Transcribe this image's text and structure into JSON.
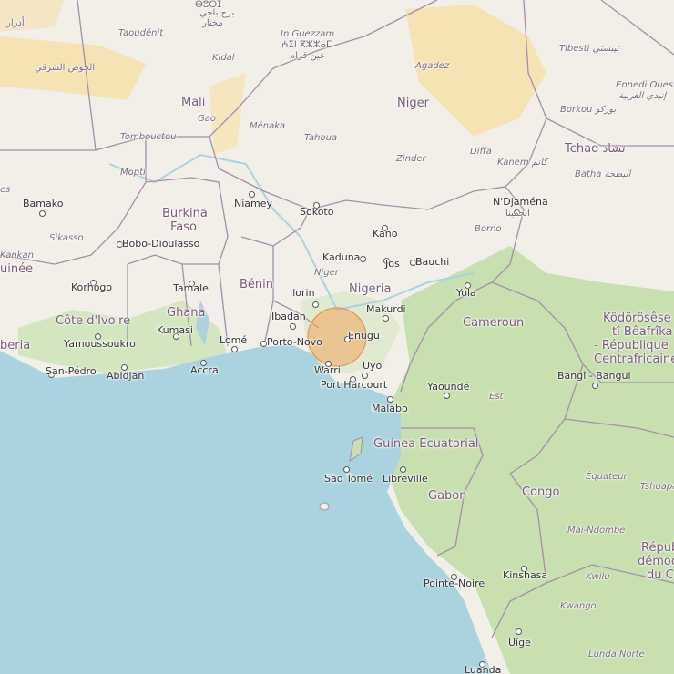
{
  "map": {
    "countries": [
      {
        "id": "mali",
        "text": "Mali"
      },
      {
        "id": "niger",
        "text": "Niger"
      },
      {
        "id": "tchad",
        "text": "Tchad تشاد"
      },
      {
        "id": "burkina",
        "text": "Burkina"
      },
      {
        "id": "faso",
        "text": "Faso"
      },
      {
        "id": "benin",
        "text": "Bénin"
      },
      {
        "id": "nigeria",
        "text": "Nigeria"
      },
      {
        "id": "ghana",
        "text": "Ghana"
      },
      {
        "id": "cotedivoire",
        "text": "Côte d'Ivoire"
      },
      {
        "id": "guinee",
        "text": "uinée"
      },
      {
        "id": "liberia",
        "text": "beria"
      },
      {
        "id": "cameroun",
        "text": "Cameroun"
      },
      {
        "id": "car1",
        "text": "Ködörösêse"
      },
      {
        "id": "car2",
        "text": "tî Bêafrîka"
      },
      {
        "id": "car3",
        "text": "- République"
      },
      {
        "id": "car4",
        "text": "Centrafricaine"
      },
      {
        "id": "guinea_eq",
        "text": "Guinea Ecuatorial"
      },
      {
        "id": "gabon",
        "text": "Gabon"
      },
      {
        "id": "congo",
        "text": "Congo"
      },
      {
        "id": "drc1",
        "text": "Républ"
      },
      {
        "id": "drc2",
        "text": "démocra"
      },
      {
        "id": "drc3",
        "text": "du Co"
      }
    ],
    "regions": [
      {
        "id": "taoudenit",
        "text": "Taoudénit"
      },
      {
        "id": "kidal",
        "text": "Kidal"
      },
      {
        "id": "gao",
        "text": "Gao"
      },
      {
        "id": "menaka",
        "text": "Ménaka"
      },
      {
        "id": "tombouctou",
        "text": "Tombouctou"
      },
      {
        "id": "mopti",
        "text": "Mopti"
      },
      {
        "id": "tahoua",
        "text": "Tahoua"
      },
      {
        "id": "agadez",
        "text": "Agadez"
      },
      {
        "id": "zinder",
        "text": "Zinder"
      },
      {
        "id": "diffa",
        "text": "Diffa"
      },
      {
        "id": "kanem",
        "text": "Kanem كانم"
      },
      {
        "id": "batha",
        "text": "Batha البطحة"
      },
      {
        "id": "borkou",
        "text": "Borkou بوركو"
      },
      {
        "id": "ennedi1",
        "text": "Ennedi Ouest"
      },
      {
        "id": "ennedi2",
        "text": "إنيدي الغربية"
      },
      {
        "id": "tibesti",
        "text": "Tibesti تيبستي"
      },
      {
        "id": "sikasso",
        "text": "Sikasso"
      },
      {
        "id": "kankan",
        "text": "Kankan"
      },
      {
        "id": "niger_river",
        "text": "Niger"
      },
      {
        "id": "borno",
        "text": "Borno"
      },
      {
        "id": "est",
        "text": "Est"
      },
      {
        "id": "equateur",
        "text": "Équateur"
      },
      {
        "id": "tshuapa",
        "text": "Tshuapa"
      },
      {
        "id": "maindombe",
        "text": "Mai-Ndombe"
      },
      {
        "id": "kwilu",
        "text": "Kwilu"
      },
      {
        "id": "kwango",
        "text": "Kwango"
      },
      {
        "id": "lundanorte",
        "text": "Lunda Norte"
      },
      {
        "id": "es",
        "text": "es"
      },
      {
        "id": "adrar",
        "text": "أدرار"
      },
      {
        "id": "hodh",
        "text": "الحوض الشرقي"
      },
      {
        "id": "inguezzam1",
        "text": "In Guezzam"
      },
      {
        "id": "inguezzam2",
        "text": "ⵄⵉⵏ ⴳⵣⵣⴰⵎ"
      },
      {
        "id": "inguezzam3",
        "text": "عين قزام"
      },
      {
        "id": "bbm1",
        "text": "ⴱⵓⵔⵊ"
      },
      {
        "id": "bbm2",
        "text": "برج باجي"
      },
      {
        "id": "bbm3",
        "text": "مختار"
      }
    ],
    "cities": [
      {
        "id": "bamako",
        "text": "Bamako"
      },
      {
        "id": "niamey",
        "text": "Niamey"
      },
      {
        "id": "sokoto",
        "text": "Sokoto"
      },
      {
        "id": "kano",
        "text": "Kano"
      },
      {
        "id": "kaduna",
        "text": "Kaduna"
      },
      {
        "id": "jos",
        "text": "Jos"
      },
      {
        "id": "bauchi",
        "text": "Bauchi"
      },
      {
        "id": "ndjamena1",
        "text": "N'Djaména"
      },
      {
        "id": "ndjamena2",
        "text": "انجمينا"
      },
      {
        "id": "bobo",
        "text": "Bobo-Dioulasso"
      },
      {
        "id": "korhogo",
        "text": "Korhogo"
      },
      {
        "id": "tamale",
        "text": "Tamale"
      },
      {
        "id": "ilorin",
        "text": "Ilorin"
      },
      {
        "id": "yola",
        "text": "Yola"
      },
      {
        "id": "ibadan",
        "text": "Ibadan"
      },
      {
        "id": "makurdi",
        "text": "Makurdi"
      },
      {
        "id": "kumasi",
        "text": "Kumasi"
      },
      {
        "id": "yamoussoukro",
        "text": "Yamoussoukro"
      },
      {
        "id": "lome",
        "text": "Lomé"
      },
      {
        "id": "portonovo",
        "text": "Porto-Novo"
      },
      {
        "id": "enugu",
        "text": "Enugu"
      },
      {
        "id": "sanpedro",
        "text": "San-Pédro"
      },
      {
        "id": "abidjan",
        "text": "Abidjan"
      },
      {
        "id": "accra",
        "text": "Accra"
      },
      {
        "id": "warri",
        "text": "Warri"
      },
      {
        "id": "uyo",
        "text": "Uyo"
      },
      {
        "id": "portharcourt",
        "text": "Port Harcourt"
      },
      {
        "id": "yaounde",
        "text": "Yaoundé"
      },
      {
        "id": "bangui",
        "text": "Bangî - Bangui"
      },
      {
        "id": "malabo",
        "text": "Malabo"
      },
      {
        "id": "saotome",
        "text": "São Tomé"
      },
      {
        "id": "libreville",
        "text": "Libreville"
      },
      {
        "id": "pointenoire",
        "text": "Pointe-Noire"
      },
      {
        "id": "kinshasa",
        "text": "Kinshasa"
      },
      {
        "id": "uige",
        "text": "Uíge"
      },
      {
        "id": "luanda",
        "text": "Luanda"
      }
    ],
    "marker": {
      "label": "location-circle",
      "color": "#f4a460"
    },
    "colors": {
      "land": "#f2efe9",
      "water": "#aad3df",
      "forest": "#c8dfb0",
      "desert": "#f5e3b3",
      "border": "#a48ea8"
    }
  }
}
